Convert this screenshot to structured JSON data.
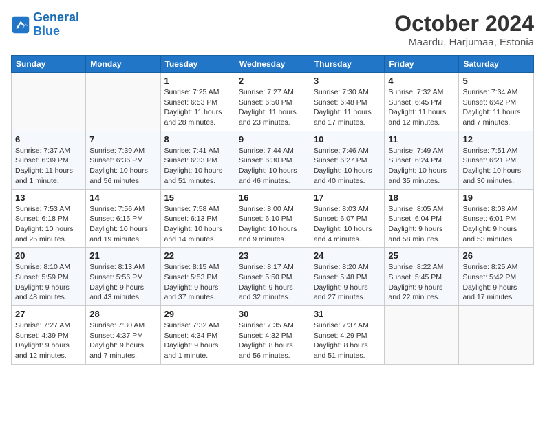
{
  "header": {
    "logo_general": "General",
    "logo_blue": "Blue",
    "month": "October 2024",
    "location": "Maardu, Harjumaa, Estonia"
  },
  "days_of_week": [
    "Sunday",
    "Monday",
    "Tuesday",
    "Wednesday",
    "Thursday",
    "Friday",
    "Saturday"
  ],
  "weeks": [
    [
      {
        "num": "",
        "detail": ""
      },
      {
        "num": "",
        "detail": ""
      },
      {
        "num": "1",
        "detail": "Sunrise: 7:25 AM\nSunset: 6:53 PM\nDaylight: 11 hours\nand 28 minutes."
      },
      {
        "num": "2",
        "detail": "Sunrise: 7:27 AM\nSunset: 6:50 PM\nDaylight: 11 hours\nand 23 minutes."
      },
      {
        "num": "3",
        "detail": "Sunrise: 7:30 AM\nSunset: 6:48 PM\nDaylight: 11 hours\nand 17 minutes."
      },
      {
        "num": "4",
        "detail": "Sunrise: 7:32 AM\nSunset: 6:45 PM\nDaylight: 11 hours\nand 12 minutes."
      },
      {
        "num": "5",
        "detail": "Sunrise: 7:34 AM\nSunset: 6:42 PM\nDaylight: 11 hours\nand 7 minutes."
      }
    ],
    [
      {
        "num": "6",
        "detail": "Sunrise: 7:37 AM\nSunset: 6:39 PM\nDaylight: 11 hours\nand 1 minute."
      },
      {
        "num": "7",
        "detail": "Sunrise: 7:39 AM\nSunset: 6:36 PM\nDaylight: 10 hours\nand 56 minutes."
      },
      {
        "num": "8",
        "detail": "Sunrise: 7:41 AM\nSunset: 6:33 PM\nDaylight: 10 hours\nand 51 minutes."
      },
      {
        "num": "9",
        "detail": "Sunrise: 7:44 AM\nSunset: 6:30 PM\nDaylight: 10 hours\nand 46 minutes."
      },
      {
        "num": "10",
        "detail": "Sunrise: 7:46 AM\nSunset: 6:27 PM\nDaylight: 10 hours\nand 40 minutes."
      },
      {
        "num": "11",
        "detail": "Sunrise: 7:49 AM\nSunset: 6:24 PM\nDaylight: 10 hours\nand 35 minutes."
      },
      {
        "num": "12",
        "detail": "Sunrise: 7:51 AM\nSunset: 6:21 PM\nDaylight: 10 hours\nand 30 minutes."
      }
    ],
    [
      {
        "num": "13",
        "detail": "Sunrise: 7:53 AM\nSunset: 6:18 PM\nDaylight: 10 hours\nand 25 minutes."
      },
      {
        "num": "14",
        "detail": "Sunrise: 7:56 AM\nSunset: 6:15 PM\nDaylight: 10 hours\nand 19 minutes."
      },
      {
        "num": "15",
        "detail": "Sunrise: 7:58 AM\nSunset: 6:13 PM\nDaylight: 10 hours\nand 14 minutes."
      },
      {
        "num": "16",
        "detail": "Sunrise: 8:00 AM\nSunset: 6:10 PM\nDaylight: 10 hours\nand 9 minutes."
      },
      {
        "num": "17",
        "detail": "Sunrise: 8:03 AM\nSunset: 6:07 PM\nDaylight: 10 hours\nand 4 minutes."
      },
      {
        "num": "18",
        "detail": "Sunrise: 8:05 AM\nSunset: 6:04 PM\nDaylight: 9 hours\nand 58 minutes."
      },
      {
        "num": "19",
        "detail": "Sunrise: 8:08 AM\nSunset: 6:01 PM\nDaylight: 9 hours\nand 53 minutes."
      }
    ],
    [
      {
        "num": "20",
        "detail": "Sunrise: 8:10 AM\nSunset: 5:59 PM\nDaylight: 9 hours\nand 48 minutes."
      },
      {
        "num": "21",
        "detail": "Sunrise: 8:13 AM\nSunset: 5:56 PM\nDaylight: 9 hours\nand 43 minutes."
      },
      {
        "num": "22",
        "detail": "Sunrise: 8:15 AM\nSunset: 5:53 PM\nDaylight: 9 hours\nand 37 minutes."
      },
      {
        "num": "23",
        "detail": "Sunrise: 8:17 AM\nSunset: 5:50 PM\nDaylight: 9 hours\nand 32 minutes."
      },
      {
        "num": "24",
        "detail": "Sunrise: 8:20 AM\nSunset: 5:48 PM\nDaylight: 9 hours\nand 27 minutes."
      },
      {
        "num": "25",
        "detail": "Sunrise: 8:22 AM\nSunset: 5:45 PM\nDaylight: 9 hours\nand 22 minutes."
      },
      {
        "num": "26",
        "detail": "Sunrise: 8:25 AM\nSunset: 5:42 PM\nDaylight: 9 hours\nand 17 minutes."
      }
    ],
    [
      {
        "num": "27",
        "detail": "Sunrise: 7:27 AM\nSunset: 4:39 PM\nDaylight: 9 hours\nand 12 minutes."
      },
      {
        "num": "28",
        "detail": "Sunrise: 7:30 AM\nSunset: 4:37 PM\nDaylight: 9 hours\nand 7 minutes."
      },
      {
        "num": "29",
        "detail": "Sunrise: 7:32 AM\nSunset: 4:34 PM\nDaylight: 9 hours\nand 1 minute."
      },
      {
        "num": "30",
        "detail": "Sunrise: 7:35 AM\nSunset: 4:32 PM\nDaylight: 8 hours\nand 56 minutes."
      },
      {
        "num": "31",
        "detail": "Sunrise: 7:37 AM\nSunset: 4:29 PM\nDaylight: 8 hours\nand 51 minutes."
      },
      {
        "num": "",
        "detail": ""
      },
      {
        "num": "",
        "detail": ""
      }
    ]
  ]
}
